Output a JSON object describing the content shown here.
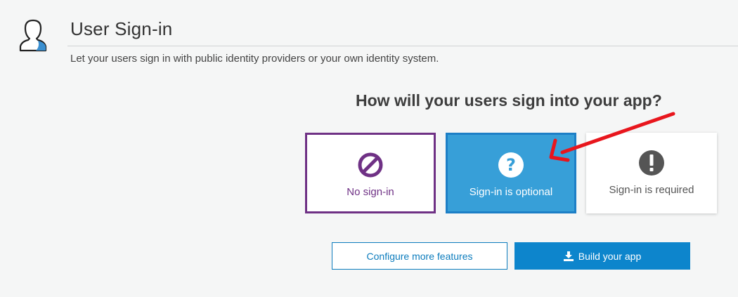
{
  "header": {
    "title": "User Sign-in",
    "subtitle": "Let your users sign in with public identity providers or your own identity system.",
    "icon": "user-silhouette-icon"
  },
  "question": "How will your users sign into your app?",
  "options": [
    {
      "label": "No sign-in",
      "icon": "prohibited-icon",
      "selected": false,
      "color": "#6f3185"
    },
    {
      "label": "Sign-in is optional",
      "icon": "question-circle-icon",
      "selected": true,
      "color": "#379fd8"
    },
    {
      "label": "Sign-in is required",
      "icon": "exclamation-circle-icon",
      "selected": false,
      "color": "#555555"
    }
  ],
  "annotation": {
    "icon": "red-arrow",
    "color": "#e8161d"
  },
  "actions": {
    "configure_label": "Configure more features",
    "build_label": "Build your app",
    "build_icon": "download-icon"
  },
  "colors": {
    "accent": "#0d85cc",
    "background": "#f5f6f6"
  }
}
